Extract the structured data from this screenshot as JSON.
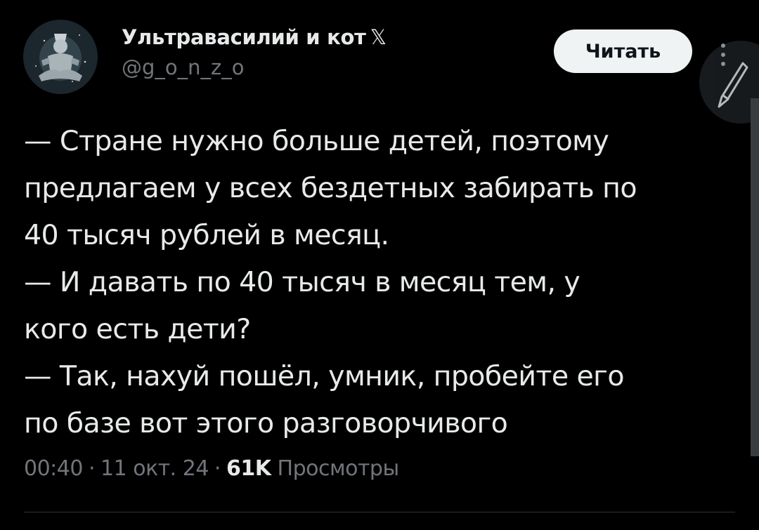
{
  "author": {
    "display_name": "Ультравасилий и кот",
    "display_name_emoji": "𝕏",
    "handle": "@g_o_n_z_o"
  },
  "actions": {
    "read_label": "Читать"
  },
  "tweet": {
    "lines": [
      "— Стране нужно больше детей, поэтому",
      "предлагаем у всех бездетных забирать по",
      "40 тысяч рублей в месяц.",
      "— И давать по 40 тысяч в месяц тем, у",
      "кого есть дети?",
      "— Так, нахуй пошёл, умник, пробейте его",
      "по базе вот этого разговорчивого"
    ]
  },
  "meta": {
    "time": "00:40",
    "date": "11 окт. 24",
    "views_count": "61K",
    "views_label": "Просмотры",
    "separator": "·"
  },
  "icons": {
    "avatar": "avatar-image",
    "more": "more-vertical-icon",
    "compose": "feather-pen-icon"
  },
  "colors": {
    "background": "#000000",
    "text_primary": "#e7e9ea",
    "text_secondary": "#71767b",
    "button_bg": "#eff3f4",
    "button_text": "#0f1419",
    "divider": "#2f3336"
  }
}
